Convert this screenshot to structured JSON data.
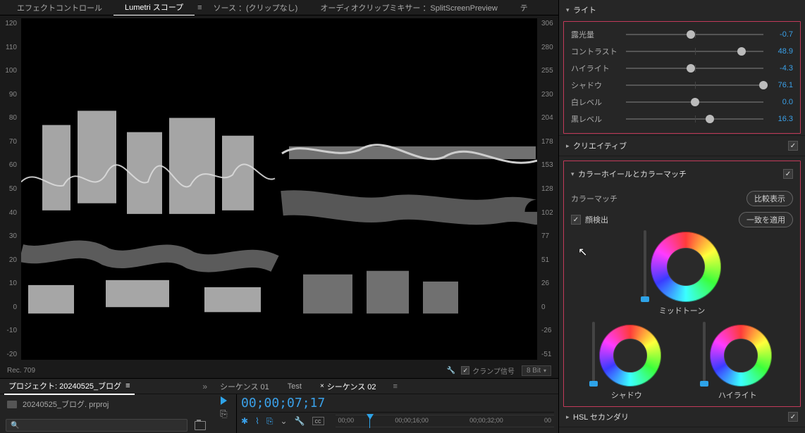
{
  "tabs": {
    "effectControls": "エフェクトコントロール",
    "lumetriScope": "Lumetri スコープ",
    "sourceNone": "ソース ：(クリップなし)",
    "audioMixer": "オーディオクリップミキサー ：SplitScreenPreview",
    "truncated": "テ"
  },
  "scope": {
    "axisLeft": [
      "120",
      "110",
      "100",
      "90",
      "80",
      "70",
      "60",
      "50",
      "40",
      "30",
      "20",
      "10",
      "0",
      "-10",
      "-20"
    ],
    "axisRight": [
      "306",
      "280",
      "255",
      "230",
      "204",
      "178",
      "153",
      "128",
      "102",
      "77",
      "51",
      "26",
      "0",
      "-26",
      "-51"
    ],
    "rec": "Rec. 709",
    "clamp": "クランプ信号",
    "bit": "8 Bit"
  },
  "project": {
    "tab": "プロジェクト: 20240525_ブログ",
    "file": "20240525_ブログ. prproj"
  },
  "timeline": {
    "tabs": {
      "seq01": "シーケンス 01",
      "test": "Test",
      "seq02": "シーケンス 02"
    },
    "timecode": "00;00;07;17",
    "ruler": [
      "00;00",
      "00;00;16;00",
      "00;00;32;00",
      "00"
    ]
  },
  "lumetri": {
    "light_section": "ライト",
    "light": {
      "exposure": {
        "label": "露光量",
        "value": "-0.7",
        "pos": 47
      },
      "contrast": {
        "label": "コントラスト",
        "value": "48.9",
        "pos": 84
      },
      "highlights": {
        "label": "ハイライト",
        "value": "-4.3",
        "pos": 47
      },
      "shadows": {
        "label": "シャドウ",
        "value": "76.1",
        "pos": 100
      },
      "whites": {
        "label": "白レベル",
        "value": "0.0",
        "pos": 50
      },
      "blacks": {
        "label": "黒レベル",
        "value": "16.3",
        "pos": 61
      }
    },
    "creative_section": "クリエイティブ",
    "wheels_section": "カラーホイールとカラーマッチ",
    "colorMatch": {
      "label": "カラーマッチ",
      "compareBtn": "比較表示",
      "faceDetect": "顔検出",
      "applyBtn": "一致を適用"
    },
    "wheels": {
      "mid": "ミッドトーン",
      "shadow": "シャドウ",
      "highlight": "ハイライト"
    },
    "hsl_section": "HSL セカンダリ"
  }
}
